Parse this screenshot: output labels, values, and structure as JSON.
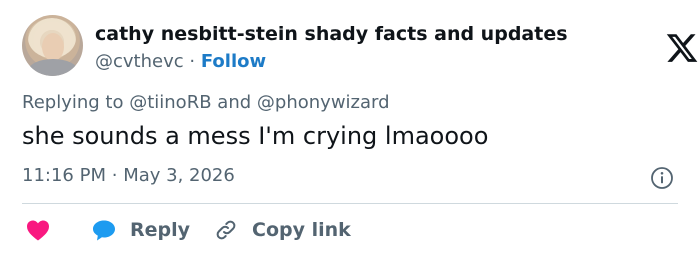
{
  "header": {
    "display_name": "cathy nesbitt-stein shady facts and updates",
    "handle": "@cvthevc",
    "separator": "·",
    "follow_label": "Follow",
    "brand_icon": "x-logo-icon"
  },
  "tweet": {
    "replying_prefix": "Replying to",
    "mention_1": "@tiinoRB",
    "and_word": "and",
    "mention_2": "@phonywizard",
    "text": "she sounds a mess I'm crying lmaoooo",
    "time": "11:16 PM",
    "date_separator": "·",
    "date": "May 3, 2026"
  },
  "actions": {
    "like_icon": "heart-icon",
    "reply_label": "Reply",
    "copy_label": "Copy link"
  },
  "colors": {
    "like": "#f91880",
    "reply_bubble": "#1d9bf0",
    "follow": "#1d7bc7",
    "secondary_text": "#536471"
  }
}
